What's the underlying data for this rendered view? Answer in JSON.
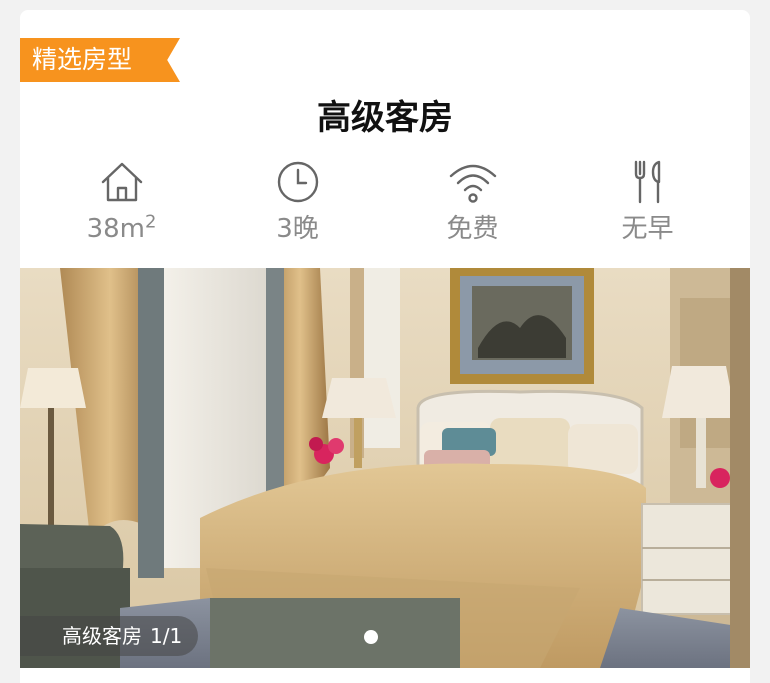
{
  "badge": {
    "label": "精选房型"
  },
  "room": {
    "title": "高级客房"
  },
  "features": [
    {
      "icon": "house-icon",
      "label": "38m",
      "sup": "2"
    },
    {
      "icon": "clock-icon",
      "label": "3晚"
    },
    {
      "icon": "wifi-icon",
      "label": "免费"
    },
    {
      "icon": "fork-knife-icon",
      "label": "无早"
    }
  ],
  "gallery": {
    "caption_title": "高级客房",
    "counter": "1/1",
    "current_slide": 1,
    "total_slides": 1
  },
  "colors": {
    "badge_bg": "#f7931e",
    "feature_text": "#8a8a8a",
    "title_text": "#111111"
  }
}
